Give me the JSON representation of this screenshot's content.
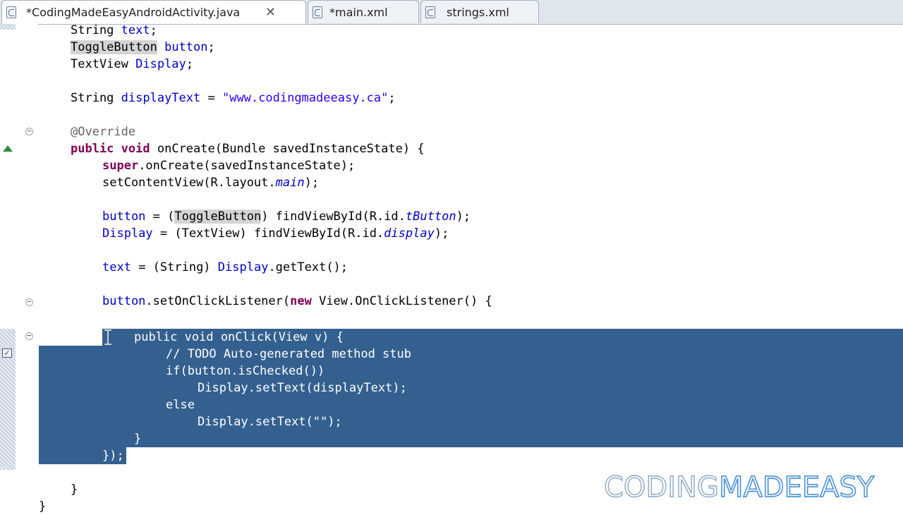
{
  "tabs": [
    {
      "label": "*CodingMadeEasyAndroidActivity.java",
      "active": true,
      "close": "✕",
      "icon": "java-file-icon"
    },
    {
      "label": "*main.xml",
      "active": false,
      "icon": "xml-file-icon"
    },
    {
      "label": "strings.xml",
      "active": false,
      "icon": "xml-file-icon"
    }
  ],
  "code": {
    "l1": [
      "String ",
      "text",
      ";"
    ],
    "l2": [
      "ToggleButton",
      " ",
      "button",
      ";"
    ],
    "l3": [
      "TextView ",
      "Display",
      ";"
    ],
    "l5": [
      "String ",
      "displayText",
      " = ",
      "\"www.codingmadeeasy.ca\"",
      ";"
    ],
    "l7": [
      "@Override"
    ],
    "l8": [
      "public",
      " ",
      "void",
      " onCreate(Bundle savedInstanceState) {"
    ],
    "l9": [
      "super",
      ".onCreate(savedInstanceState);"
    ],
    "l10": [
      "setContentView(R.layout.",
      "main",
      ");"
    ],
    "l12": [
      "button",
      " = (",
      "ToggleButton",
      ") findViewById(R.id.",
      "tButton",
      ");"
    ],
    "l13": [
      "Display",
      " = (TextView) findViewById(R.id.",
      "display",
      ");"
    ],
    "l15": [
      "text",
      " = (String) ",
      "Display",
      ".getText();"
    ],
    "l17": [
      "button",
      ".setOnClickListener(",
      "new",
      " View.OnClickListener() {"
    ],
    "l19": [
      "public void onClick(View v) {"
    ],
    "l20": [
      "// TODO Auto-generated method stub"
    ],
    "l21": [
      "if(button.isChecked())"
    ],
    "l22": [
      "Display.setText(displayText);"
    ],
    "l23": [
      "else"
    ],
    "l24": [
      "Display.setText(\"\");"
    ],
    "l25": [
      "}"
    ],
    "l26": [
      "});"
    ],
    "l28": [
      "}"
    ],
    "l29": [
      "}"
    ]
  },
  "watermark": {
    "part1": "CODING",
    "part2": "MADE",
    "part3": "EASY"
  },
  "colors": {
    "keyword": "#7f0055",
    "field": "#0000c0",
    "string": "#2a00ff",
    "annotation": "#646464",
    "selection": "#33608f",
    "watermark_accent": "#3f88d0"
  }
}
